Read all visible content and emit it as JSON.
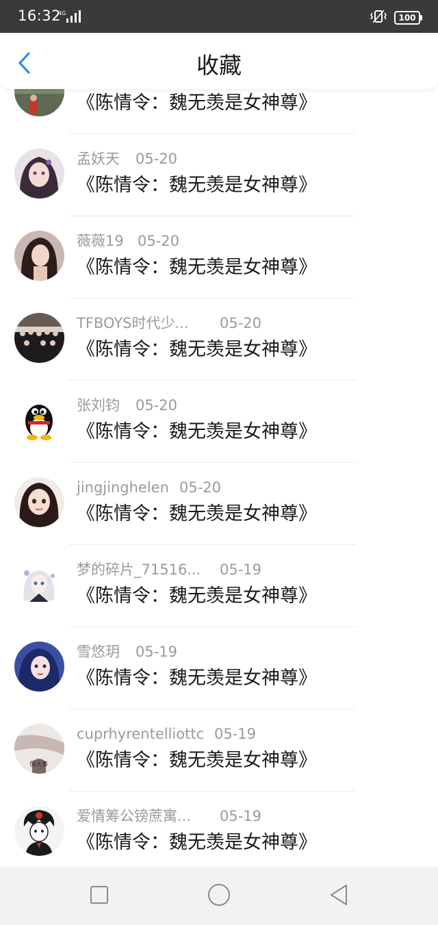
{
  "status_bar": {
    "time": "16:32",
    "network": "4G",
    "battery": "100"
  },
  "header": {
    "title": "收藏",
    "back_icon": "chevron-left-icon",
    "accent_color": "#2a8ef0"
  },
  "items": [
    {
      "name": "",
      "date": "",
      "title": "《陈情令：魏无羡是女神尊》",
      "avatar": "avatar-outdoor-person"
    },
    {
      "name": "孟妖天",
      "date": "05-20",
      "title": "《陈情令：魏无羡是女神尊》",
      "avatar": "avatar-anime-girl"
    },
    {
      "name": "薇薇19",
      "date": "05-20",
      "title": "《陈情令：魏无羡是女神尊》",
      "avatar": "avatar-woman-photo"
    },
    {
      "name": "TFBOYS时代少...",
      "date": "05-20",
      "title": "《陈情令：魏无羡是女神尊》",
      "avatar": "avatar-group-photo"
    },
    {
      "name": "张刘钧",
      "date": "05-20",
      "title": "《陈情令：魏无羡是女神尊》",
      "avatar": "avatar-qq-penguin"
    },
    {
      "name": "jingjinghelen",
      "date": "05-20",
      "title": "《陈情令：魏无羡是女神尊》",
      "avatar": "avatar-cartoon-girl"
    },
    {
      "name": "梦的碎片_71516...",
      "date": "05-19",
      "title": "《陈情令：魏无羡是女神尊》",
      "avatar": "avatar-anime-chibi"
    },
    {
      "name": "雪悠玥",
      "date": "05-19",
      "title": "《陈情令：魏无羡是女神尊》",
      "avatar": "avatar-blue-hair-girl"
    },
    {
      "name": "cuprhyrentelliottc",
      "date": "05-19",
      "title": "《陈情令：魏无羡是女神尊》",
      "avatar": "avatar-calligraphy-photo"
    },
    {
      "name": "爱情筹公镑蔗寓...",
      "date": "05-19",
      "title": "《陈情令：魏无羡是女神尊》",
      "avatar": "avatar-manga-boy"
    }
  ],
  "nav_bar": {
    "recents_icon": "square-icon",
    "home_icon": "circle-icon",
    "back_icon": "triangle-back-icon"
  }
}
